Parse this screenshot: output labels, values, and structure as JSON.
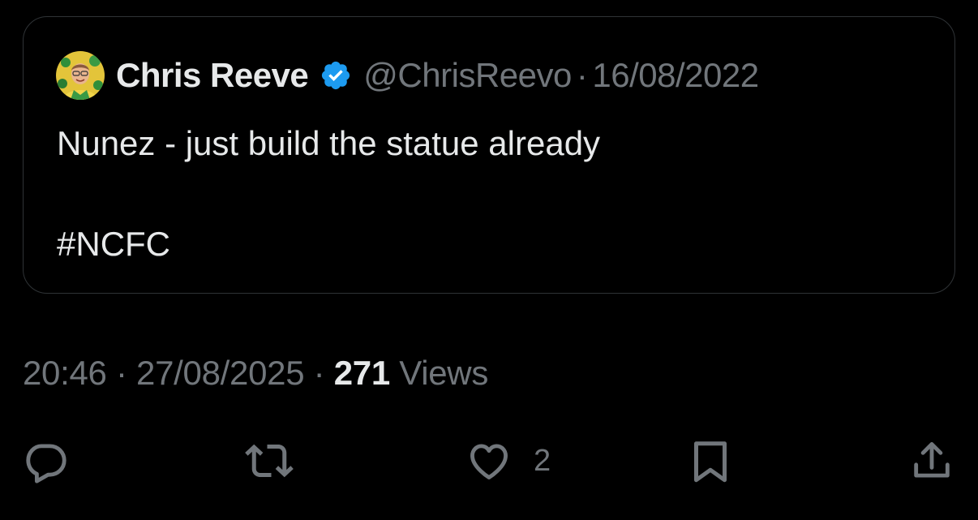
{
  "quoted_tweet": {
    "author_name": "Chris Reeve",
    "handle": "@ChrisReevo",
    "separator": "·",
    "date": "16/08/2022",
    "text": "Nunez - just build the statue already\n\n#NCFC",
    "verified_icon": "verified-badge-icon",
    "avatar": "avatar"
  },
  "tweet_meta": {
    "time": "20:46",
    "separator": "·",
    "date": "27/08/2025",
    "view_count": "271",
    "views_label": "Views"
  },
  "actions": {
    "reply_icon": "reply-icon",
    "retweet_icon": "retweet-icon",
    "like_icon": "like-icon",
    "like_count": "2",
    "bookmark_icon": "bookmark-icon",
    "share_icon": "share-icon"
  },
  "colors": {
    "background": "#000000",
    "text_primary": "#e7e9ea",
    "text_secondary": "#71767b",
    "border": "#2f3336",
    "verified": "#1d9bf0"
  }
}
